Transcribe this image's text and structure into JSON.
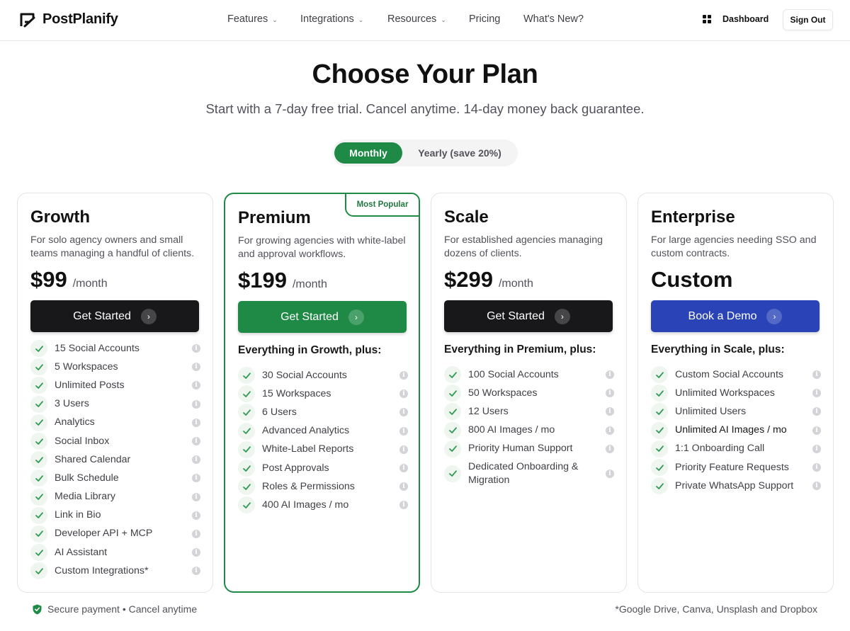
{
  "brand": {
    "name": "PostPlanify"
  },
  "nav": {
    "items": [
      {
        "label": "Features",
        "has_dropdown": true
      },
      {
        "label": "Integrations",
        "has_dropdown": true
      },
      {
        "label": "Resources",
        "has_dropdown": true
      },
      {
        "label": "Pricing",
        "has_dropdown": false
      },
      {
        "label": "What's New?",
        "has_dropdown": false
      }
    ],
    "dashboard_label": "Dashboard",
    "signout_label": "Sign Out"
  },
  "hero": {
    "title": "Choose Your Plan",
    "subtitle": "Start with a 7-day free trial. Cancel anytime. 14-day money back guarantee."
  },
  "billing_toggle": {
    "monthly_label": "Monthly",
    "yearly_label": "Yearly (save 20%)",
    "selected": "Monthly"
  },
  "colors": {
    "accent_green": "#1f8a46",
    "dark_button": "#18181b",
    "blue_button": "#2a44b8"
  },
  "plans": [
    {
      "name": "Growth",
      "description": "For solo agency owners and small teams managing a handful of clients.",
      "price": "$99",
      "price_unit": "/month",
      "cta_label": "Get Started",
      "features_heading": "",
      "features": [
        "15 Social Accounts",
        "5 Workspaces",
        "Unlimited Posts",
        "3 Users",
        "Analytics",
        "Social Inbox",
        "Shared Calendar",
        "Bulk Schedule",
        "Media Library",
        "Link in Bio",
        "Developer API + MCP",
        "AI Assistant",
        "Custom Integrations*"
      ]
    },
    {
      "name": "Premium",
      "badge": "Most Popular",
      "description": "For growing agencies with white-label and approval workflows.",
      "price": "$199",
      "price_unit": "/month",
      "cta_label": "Get Started",
      "features_heading": "Everything in Growth, plus:",
      "features": [
        "30 Social Accounts",
        "15 Workspaces",
        "6 Users",
        "Advanced Analytics",
        "White-Label Reports",
        "Post Approvals",
        "Roles & Permissions",
        "400 AI Images / mo"
      ]
    },
    {
      "name": "Scale",
      "description": "For established agencies managing dozens of clients.",
      "price": "$299",
      "price_unit": "/month",
      "cta_label": "Get Started",
      "features_heading": "Everything in Premium, plus:",
      "features": [
        "100 Social Accounts",
        "50 Workspaces",
        "12 Users",
        "800 AI Images / mo",
        "Priority Human Support",
        "Dedicated Onboarding & Migration"
      ]
    },
    {
      "name": "Enterprise",
      "description": "For large agencies needing SSO and custom contracts.",
      "price": "Custom",
      "price_unit": "",
      "cta_label": "Book a Demo",
      "features_heading": "Everything in Scale, plus:",
      "features": [
        "Custom Social Accounts",
        "Unlimited Workspaces",
        "Unlimited Users",
        "Unlimited AI Images / mo",
        "1:1 Onboarding Call",
        "Priority Feature Requests",
        "Private WhatsApp Support"
      ]
    }
  ],
  "footer": {
    "secure_text": "Secure payment • Cancel anytime",
    "footnote": "*Google Drive, Canva, Unsplash and Dropbox"
  }
}
